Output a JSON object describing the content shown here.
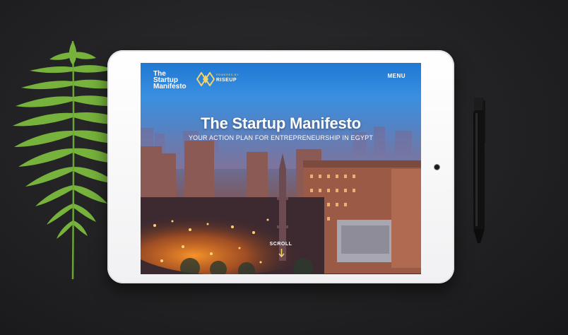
{
  "brand": {
    "logo_lines": [
      "The",
      "Startup",
      "Manifesto"
    ],
    "powered_by": "POWERED BY",
    "partner_name": "RISEUP"
  },
  "nav": {
    "menu_label": "MENU"
  },
  "hero": {
    "title": "The Startup Manifesto",
    "subtitle": "YOUR ACTION PLAN FOR ENTREPRENEURSHIP IN EGYPT"
  },
  "scroll": {
    "label": "SCROLL"
  },
  "colors": {
    "accent_yellow": "#f3d36a",
    "sky_blue": "#1f78d3",
    "city_orange": "#f08a2a"
  },
  "icons": {
    "partner_logo": "riseup-diamond-icon",
    "scroll": "arrow-down-icon"
  }
}
